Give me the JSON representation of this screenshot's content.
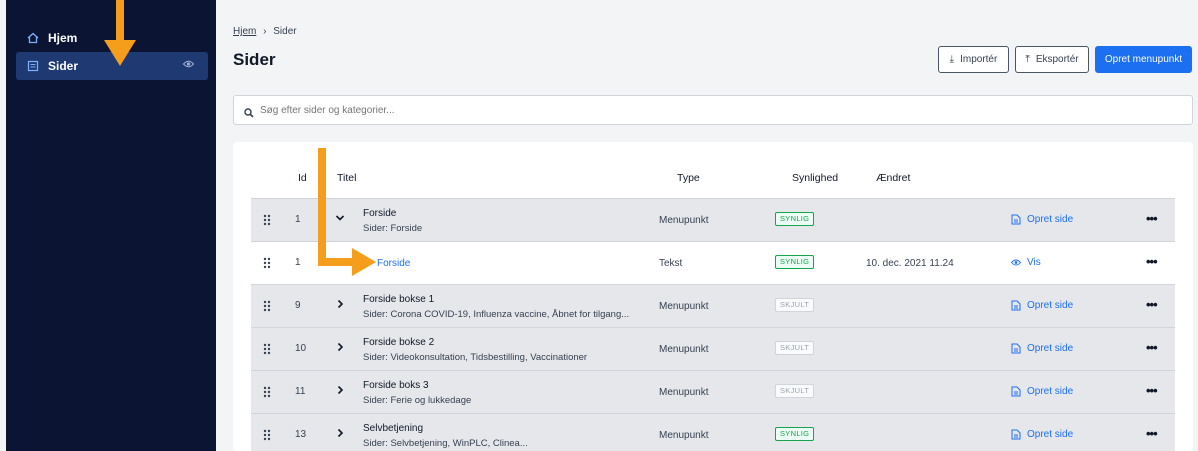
{
  "sidebar": {
    "items": [
      {
        "label": "Hjem",
        "icon": "home-icon",
        "active": false
      },
      {
        "label": "Sider",
        "icon": "pages-icon",
        "active": true,
        "trailing_icon": "eye-icon"
      }
    ]
  },
  "breadcrumb": {
    "home": "Hjem",
    "separator": "›",
    "current": "Sider"
  },
  "page_title": "Sider",
  "toolbar": {
    "import_label": "Importér",
    "export_label": "Eksportér",
    "create_label": "Opret menupunkt"
  },
  "search": {
    "placeholder": "Søg efter sider og kategorier..."
  },
  "table": {
    "headers": {
      "id": "Id",
      "title": "Titel",
      "type": "Type",
      "visibility": "Synlighed",
      "changed": "Ændret"
    },
    "rows": [
      {
        "id": "1",
        "title": "Forside",
        "subtitle": "Sider: Forside",
        "type": "Menupunkt",
        "visibility": "SYNLIG",
        "changed": "",
        "action": "Opret side",
        "expander": "chevron-down-icon"
      },
      {
        "id": "1",
        "title": "Forside",
        "subtitle": "",
        "type": "Tekst",
        "visibility": "SYNLIG",
        "changed": "10. dec. 2021 11.24",
        "action": "Vis",
        "expander": ""
      },
      {
        "id": "9",
        "title": "Forside bokse 1",
        "subtitle": "Sider: Corona COVID-19, Influenza vaccine, Åbnet for tilgang...",
        "type": "Menupunkt",
        "visibility": "SKJULT",
        "changed": "",
        "action": "Opret side",
        "expander": "chevron-right-icon"
      },
      {
        "id": "10",
        "title": "Forside bokse 2",
        "subtitle": "Sider: Videokonsultation, Tidsbestilling, Vaccinationer",
        "type": "Menupunkt",
        "visibility": "SKJULT",
        "changed": "",
        "action": "Opret side",
        "expander": "chevron-right-icon"
      },
      {
        "id": "11",
        "title": "Forside boks 3",
        "subtitle": "Sider: Ferie og lukkedage",
        "type": "Menupunkt",
        "visibility": "SKJULT",
        "changed": "",
        "action": "Opret side",
        "expander": "chevron-right-icon"
      },
      {
        "id": "13",
        "title": "Selvbetjening",
        "subtitle": "Sider: Selvbetjening, WinPLC, Clinea...",
        "type": "Menupunkt",
        "visibility": "SYNLIG",
        "changed": "",
        "action": "Opret side",
        "expander": "chevron-right-icon"
      }
    ]
  },
  "colors": {
    "sidebar_bg": "#0c1433",
    "accent": "#1d6ff2",
    "visible_badge": "#16a34a",
    "hidden_badge": "#9ca3af",
    "annotation_arrow": "#f59e1b"
  }
}
